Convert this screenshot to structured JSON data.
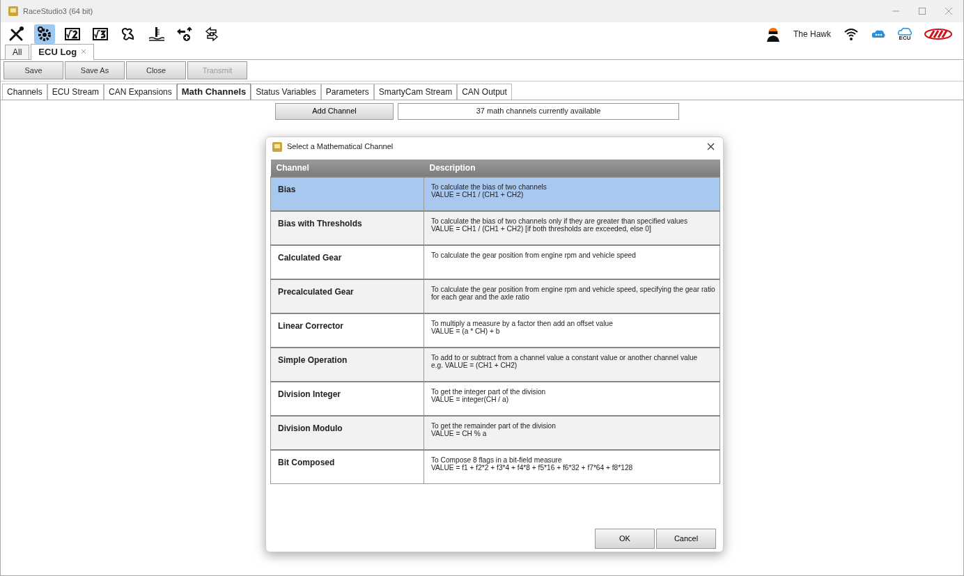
{
  "window": {
    "title": "RaceStudio3 (64 bit)"
  },
  "toolbar": [
    {
      "kind": "tools",
      "selected": false
    },
    {
      "kind": "gear",
      "selected": true
    },
    {
      "kind": "root2",
      "selected": false
    },
    {
      "kind": "root3",
      "selected": false
    },
    {
      "kind": "track",
      "selected": false
    },
    {
      "kind": "gauge",
      "selected": false
    },
    {
      "kind": "transfer-plus",
      "selected": false
    },
    {
      "kind": "transfer",
      "selected": false
    }
  ],
  "user": {
    "name": "The Hawk"
  },
  "cloud_label": "ECU",
  "doc_tabs": [
    {
      "label": "All",
      "selected": false,
      "closable": false
    },
    {
      "label": "ECU Log",
      "selected": true,
      "closable": true
    }
  ],
  "actions": [
    {
      "label": "Save",
      "disabled": false
    },
    {
      "label": "Save As",
      "disabled": false
    },
    {
      "label": "Close",
      "disabled": false
    },
    {
      "label": "Transmit",
      "disabled": true
    }
  ],
  "section_tabs": [
    {
      "label": "Channels",
      "selected": false
    },
    {
      "label": "ECU Stream",
      "selected": false
    },
    {
      "label": "CAN Expansions",
      "selected": false
    },
    {
      "label": "Math Channels",
      "selected": true
    },
    {
      "label": "Status Variables",
      "selected": false
    },
    {
      "label": "Parameters",
      "selected": false
    },
    {
      "label": "SmartyCam Stream",
      "selected": false
    },
    {
      "label": "CAN Output",
      "selected": false
    }
  ],
  "add_button": "Add Channel",
  "available": "37 math channels currently available",
  "dialog": {
    "title": "Select a Mathematical Channel",
    "columns": [
      "Channel",
      "Description"
    ],
    "rows": [
      {
        "name": "Bias",
        "description": "To calculate the bias of two channels\nVALUE = CH1 / (CH1 + CH2)",
        "selected": true
      },
      {
        "name": "Bias with Thresholds",
        "description": "To calculate the bias of two channels only if they are greater than specified values\nVALUE = CH1 / (CH1 + CH2) [if both thresholds are exceeded, else 0]",
        "selected": false
      },
      {
        "name": "Calculated Gear",
        "description": "To calculate the gear position from engine rpm and vehicle speed",
        "selected": false
      },
      {
        "name": "Precalculated Gear",
        "description": "To calculate the gear position from engine rpm and vehicle speed, specifying the gear ratio for each gear and the axle ratio",
        "selected": false
      },
      {
        "name": "Linear Corrector",
        "description": "To multiply a measure by a factor then add an offset value\nVALUE = (a * CH) + b",
        "selected": false
      },
      {
        "name": "Simple Operation",
        "description": "To add to or subtract from a channel value a constant value or another channel value\ne.g. VALUE = (CH1 + CH2)",
        "selected": false
      },
      {
        "name": "Division Integer",
        "description": "To get the integer part of the division\nVALUE = integer(CH / a)",
        "selected": false
      },
      {
        "name": "Division Modulo",
        "description": "To get the remainder part of the division\nVALUE = CH % a",
        "selected": false
      },
      {
        "name": "Bit Composed",
        "description": "To Compose 8 flags in a bit-field measure\nVALUE = f1 + f2*2 + f3*4 + f4*8 + f5*16 + f6*32 + f7*64 + f8*128",
        "selected": false
      }
    ],
    "buttons": [
      "OK",
      "Cancel"
    ]
  }
}
